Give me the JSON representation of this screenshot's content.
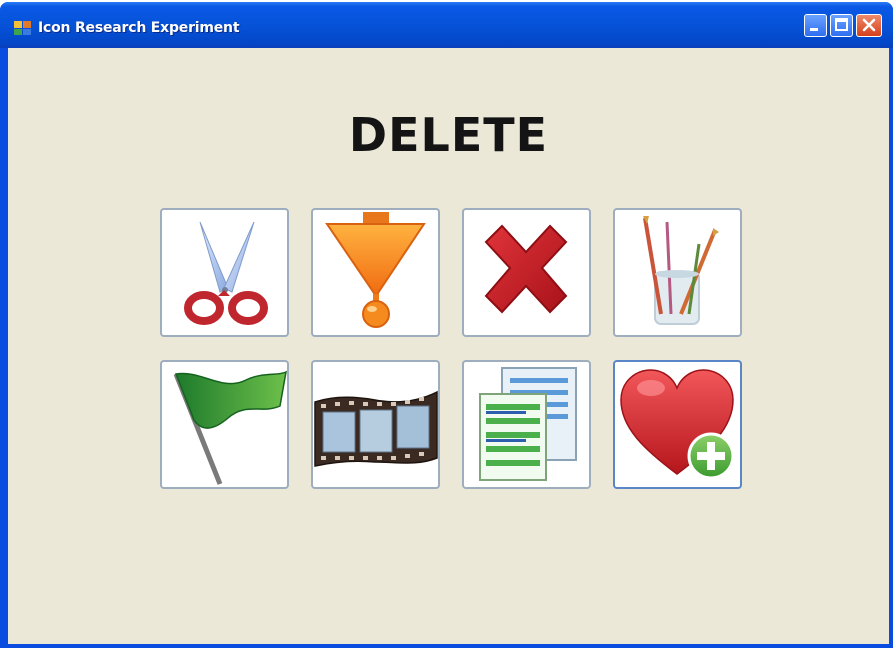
{
  "window": {
    "title": "Icon Research Experiment",
    "controls": [
      "minimize",
      "maximize",
      "close"
    ]
  },
  "prompt": {
    "word": "DELETE"
  },
  "icons": [
    {
      "name": "scissors-icon"
    },
    {
      "name": "arrow-down-icon"
    },
    {
      "name": "delete-x-icon"
    },
    {
      "name": "paint-brushes-icon"
    },
    {
      "name": "flag-icon"
    },
    {
      "name": "film-strip-icon"
    },
    {
      "name": "documents-icon"
    },
    {
      "name": "heart-add-icon"
    }
  ],
  "colors": {
    "titlebar": "#0653d8",
    "client_background": "#ebe8d8",
    "tile_border": "#9eaebe",
    "tile_border_selected": "#5a86c8"
  }
}
